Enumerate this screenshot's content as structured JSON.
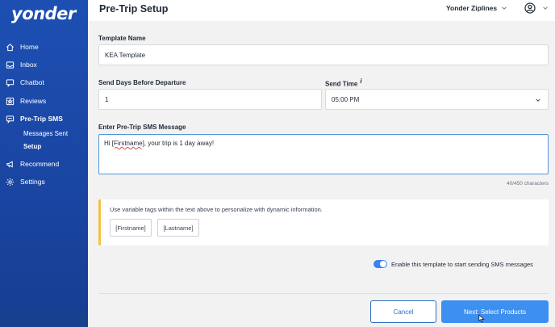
{
  "brand": {
    "logo_text": "yonder"
  },
  "colors": {
    "sidebar": "#1d4fb3",
    "accent": "#3d8ff0",
    "tips_border": "#f4c242",
    "toggle_on": "#3b82f6"
  },
  "sidebar": {
    "items": [
      {
        "label": "Home",
        "icon": "home-icon"
      },
      {
        "label": "Inbox",
        "icon": "inbox-icon"
      },
      {
        "label": "Chatbot",
        "icon": "chat-icon"
      },
      {
        "label": "Reviews",
        "icon": "star-icon"
      },
      {
        "label": "Pre-Trip SMS",
        "icon": "sms-icon",
        "active": true
      },
      {
        "label": "Recommend",
        "icon": "megaphone-icon"
      },
      {
        "label": "Settings",
        "icon": "gear-icon"
      }
    ],
    "sub_items": [
      {
        "label": "Messages Sent"
      },
      {
        "label": "Setup",
        "active": true
      }
    ]
  },
  "header": {
    "title": "Pre-Trip Setup",
    "org_name": "Yonder Ziplines"
  },
  "form": {
    "template_name": {
      "label": "Template Name",
      "value": "KEA Template"
    },
    "send_days": {
      "label": "Send Days Before Departure",
      "value": "1"
    },
    "send_time": {
      "label": "Send Time",
      "info": "i",
      "value": "05:00 PM"
    },
    "message": {
      "label": "Enter Pre-Trip SMS Message",
      "value_prefix": "Hi ",
      "value_tag": "[Firstname]",
      "value_suffix": ", your trip is 1 day away!",
      "char_count": "40/450 characters"
    },
    "tips": {
      "text": "Use variable tags within the text above to personalize with dynamic information.",
      "tags": [
        "[Firstname]",
        "[Lastname]"
      ]
    },
    "enable_toggle": {
      "label": "Enable this template to start sending SMS messages",
      "on": true
    }
  },
  "actions": {
    "cancel_label": "Cancel",
    "next_label": "Next: Select Products"
  }
}
